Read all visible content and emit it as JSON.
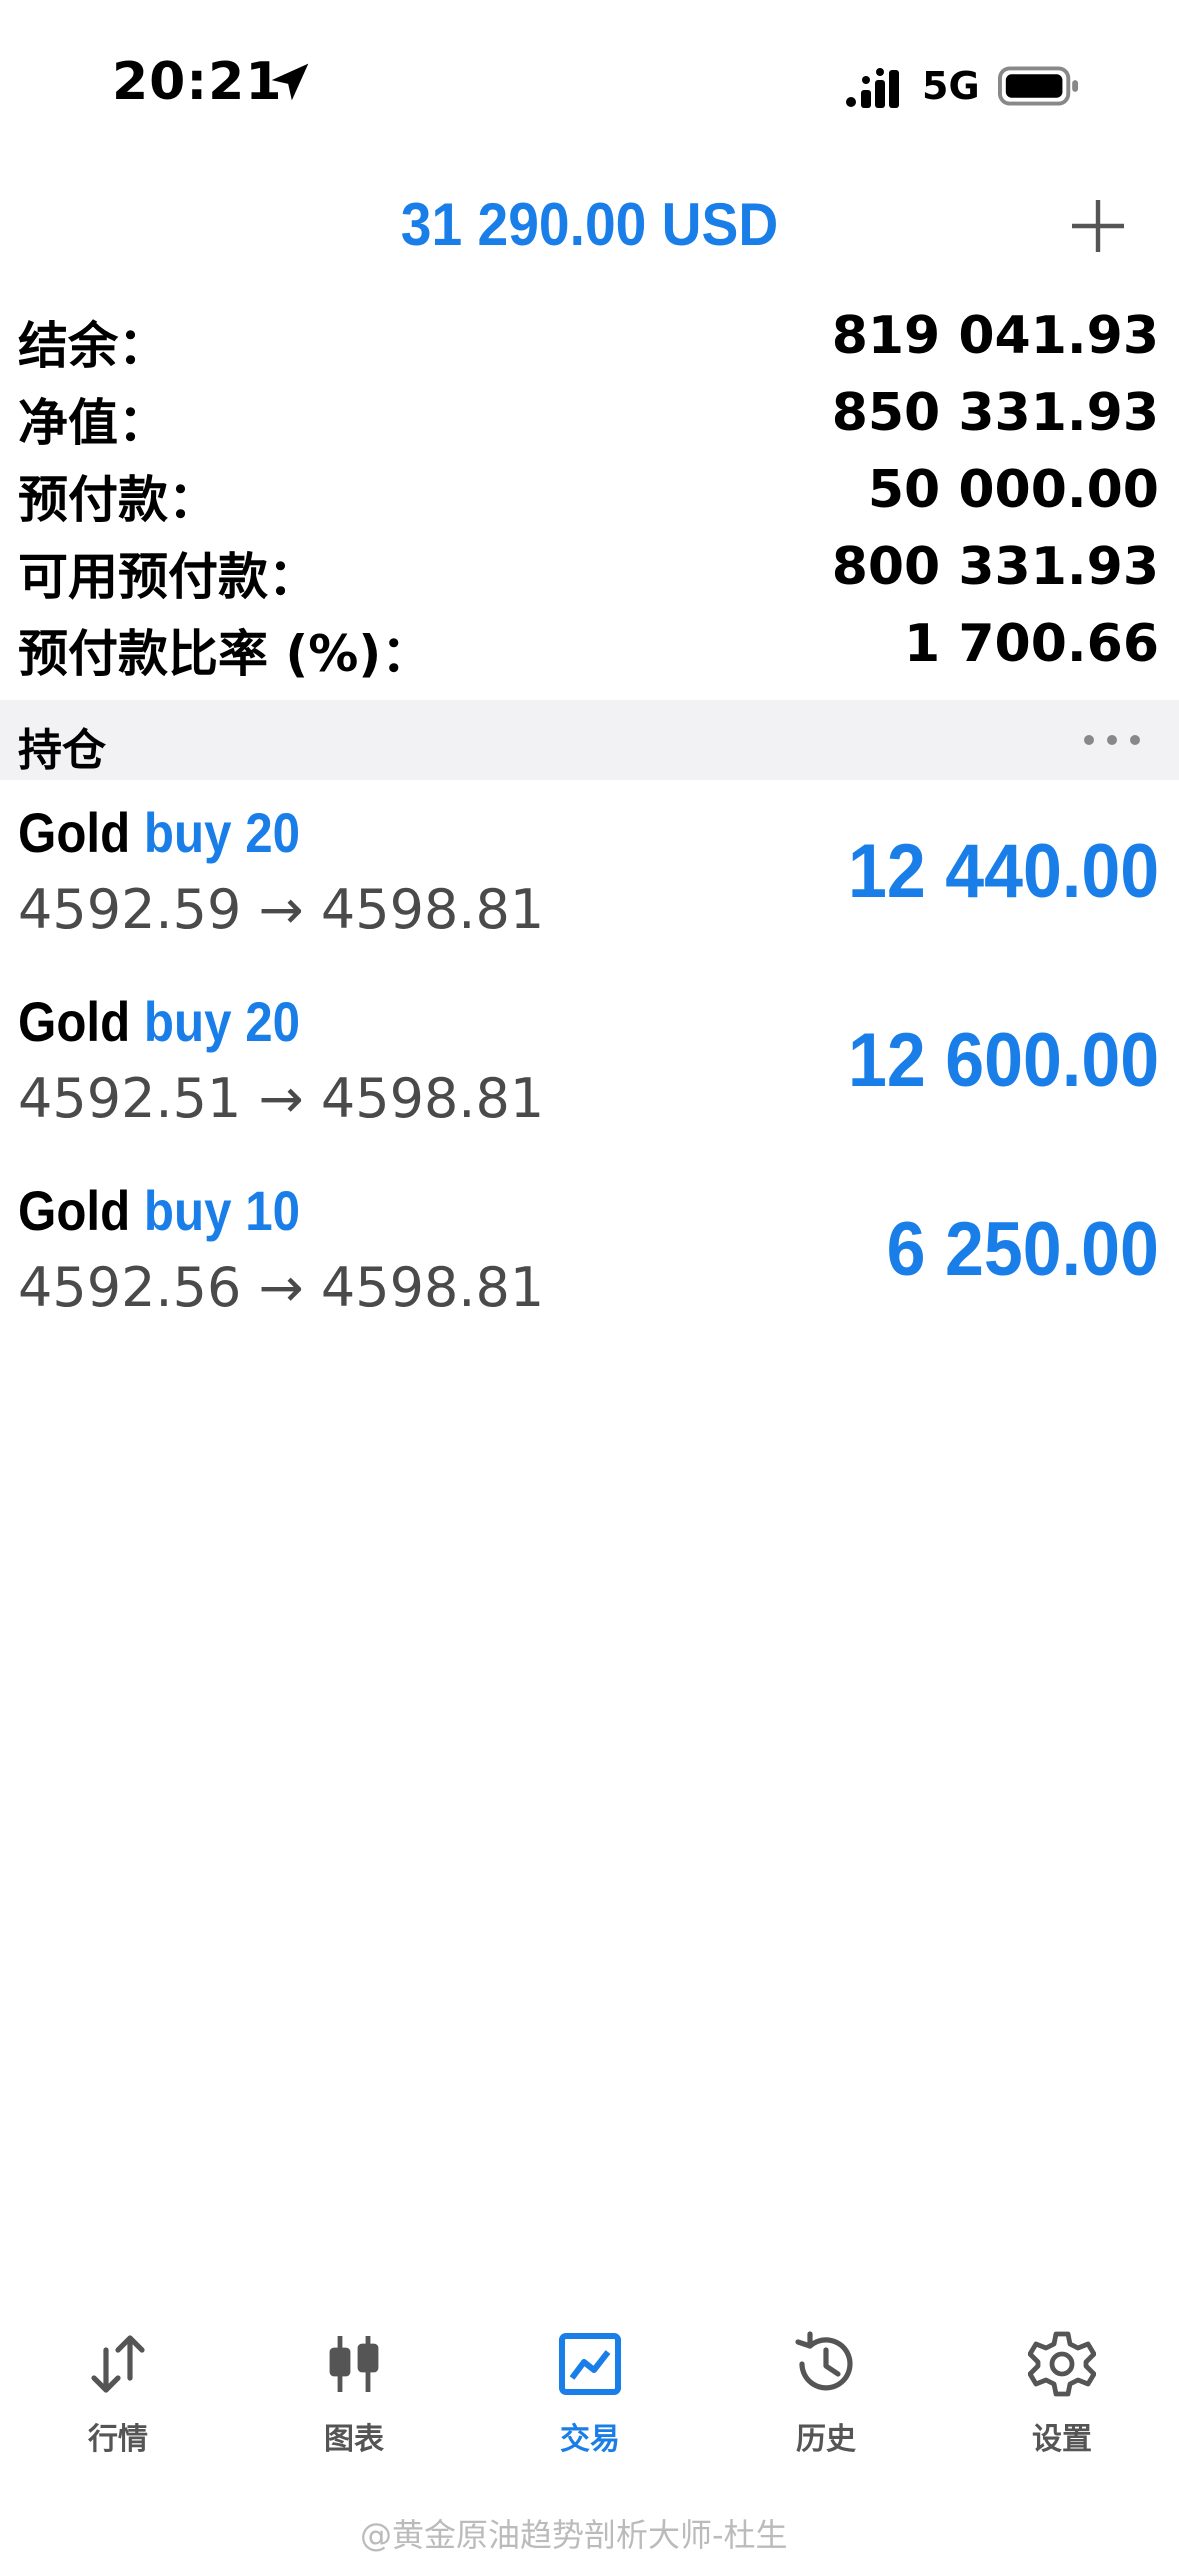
{
  "status": {
    "time": "20:21",
    "network": "5G"
  },
  "header": {
    "balance": "31 290.00 USD"
  },
  "account": [
    {
      "label": "结余：",
      "value": "819 041.93"
    },
    {
      "label": "净值：",
      "value": "850 331.93"
    },
    {
      "label": "预付款：",
      "value": "50 000.00"
    },
    {
      "label": "可用预付款：",
      "value": "800 331.93"
    },
    {
      "label": "预付款比率 (%)：",
      "value": "1 700.66"
    }
  ],
  "positions_section": {
    "title": "持仓"
  },
  "positions": [
    {
      "symbol": "Gold",
      "side": "buy 20",
      "prices": "4592.59 → 4598.81",
      "profit": "12 440.00"
    },
    {
      "symbol": "Gold",
      "side": "buy 20",
      "prices": "4592.51 → 4598.81",
      "profit": "12 600.00"
    },
    {
      "symbol": "Gold",
      "side": "buy 10",
      "prices": "4592.56 → 4598.81",
      "profit": "6 250.00"
    }
  ],
  "tabs": [
    {
      "label": "行情",
      "icon": "quotes-arrows-icon"
    },
    {
      "label": "图表",
      "icon": "candlestick-chart-icon"
    },
    {
      "label": "交易",
      "icon": "trade-chart-icon",
      "active": true
    },
    {
      "label": "历史",
      "icon": "history-clock-icon"
    },
    {
      "label": "设置",
      "icon": "gear-icon"
    }
  ],
  "watermark": "@黄金原油趋势剖析大师-杜生",
  "colors": {
    "accent": "#1a7ee8",
    "section_bg": "#f2f2f4"
  }
}
